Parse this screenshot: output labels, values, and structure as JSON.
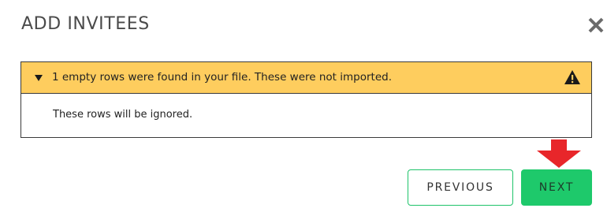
{
  "dialog": {
    "title": "ADD INVITEES",
    "close_icon": "close-icon"
  },
  "notice": {
    "message": "1 empty rows were found in your file. These were not imported.",
    "details": "These rows will be ignored.",
    "caret_icon": "caret-down-icon",
    "warning_icon": "warning-icon",
    "header_color": "#fecd5e"
  },
  "annotation": {
    "arrow_icon": "red-arrow-down-icon",
    "color": "#e8262a"
  },
  "buttons": {
    "previous_label": "PREVIOUS",
    "next_label": "NEXT",
    "accent_color": "#1ec96b"
  }
}
